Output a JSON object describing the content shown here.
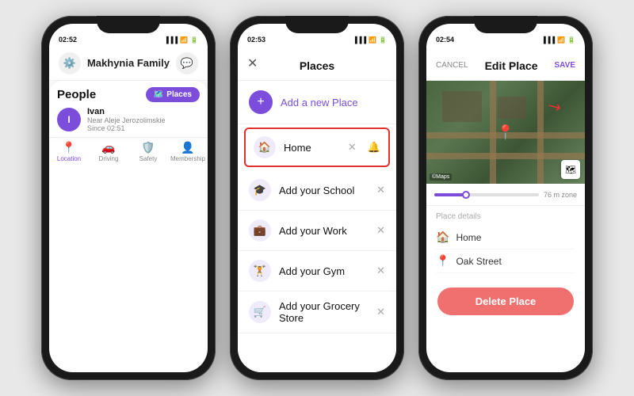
{
  "phone1": {
    "status_time": "02:52",
    "header_title": "Makhynia Family",
    "people_label": "People",
    "places_btn": "Places",
    "user_name": "Ivan",
    "user_location": "Near Aleje Jerozolimskie",
    "user_since": "Since 02:51",
    "tabs": [
      "Location",
      "Driving",
      "Safety",
      "Membership"
    ],
    "tab_icons": [
      "📍",
      "🚗",
      "🛡️",
      "👤"
    ]
  },
  "phone2": {
    "status_time": "02:53",
    "header_title": "Places",
    "close_icon": "✕",
    "add_new_label": "Add a new Place",
    "places": [
      {
        "name": "Home",
        "icon": "🏠",
        "highlighted": true
      },
      {
        "name": "Add your School",
        "icon": "🎓",
        "highlighted": false
      },
      {
        "name": "Add your Work",
        "icon": "💼",
        "highlighted": false
      },
      {
        "name": "Add your Gym",
        "icon": "🏋️",
        "highlighted": false
      },
      {
        "name": "Add your Grocery Store",
        "icon": "🛒",
        "highlighted": false
      }
    ]
  },
  "phone3": {
    "status_time": "02:54",
    "cancel_label": "CANCEL",
    "header_title": "Edit Place",
    "save_label": "SAVE",
    "zone_label": "76 m zone",
    "place_details_title": "Place details",
    "place_name": "Home",
    "place_address": "Oak Street",
    "delete_label": "Delete Place",
    "maps_label": "©Maps"
  }
}
